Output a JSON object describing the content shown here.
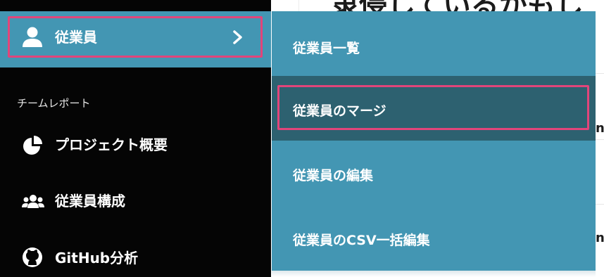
{
  "background": {
    "heading_fragment": "隶侵しているかもし",
    "side_fragment_1": "n",
    "side_fragment_2": "n"
  },
  "sidebar": {
    "active_item": {
      "label": "従業員",
      "icon": "user-icon",
      "chevron": "chevron-right-icon"
    },
    "section_title": "チームレポート",
    "items": [
      {
        "label": "プロジェクト概要",
        "icon": "pie-chart-icon"
      },
      {
        "label": "従業員構成",
        "icon": "users-icon"
      },
      {
        "label": "GitHub分析",
        "icon": "github-icon"
      }
    ]
  },
  "submenu": {
    "items": [
      {
        "label": "従業員一覧",
        "selected": false
      },
      {
        "label": "従業員のマージ",
        "selected": true
      },
      {
        "label": "従業員の編集",
        "selected": false
      },
      {
        "label": "従業員のCSV一括編集",
        "selected": false
      }
    ]
  },
  "colors": {
    "accent": "#4396b3",
    "selected": "#2d6170",
    "highlight_outline": "#e2457a",
    "sidebar_bg": "#050505"
  }
}
